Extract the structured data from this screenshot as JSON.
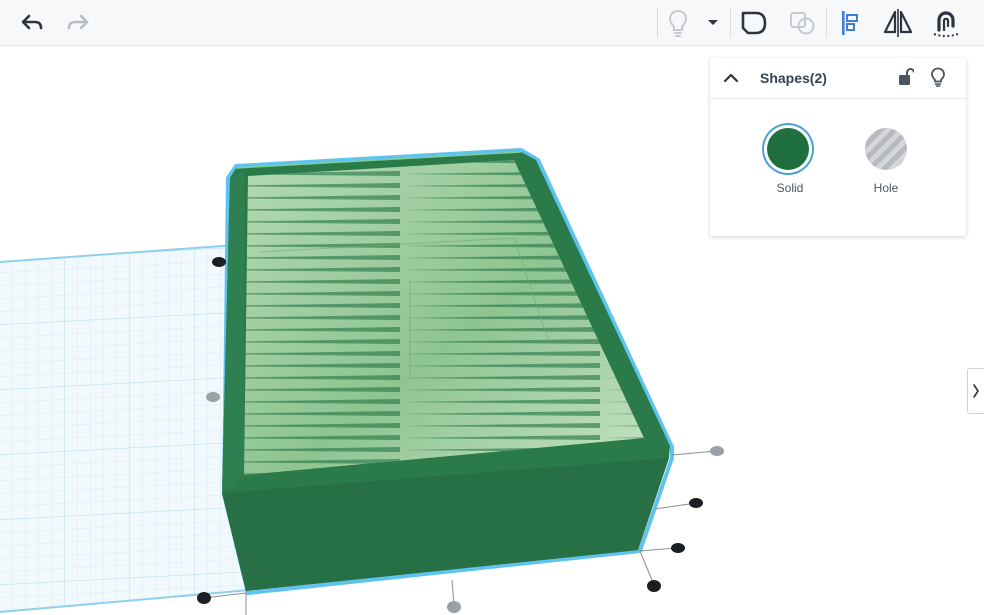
{
  "toolbar": {
    "undo_icon": "undo-arrow-icon",
    "redo_icon": "redo-arrow-icon",
    "notes_icon": "lightbulb-icon",
    "dropdown_icon": "caret-down-icon",
    "group_icon": "group-shape-icon",
    "ungroup_icon": "ungroup-shape-icon",
    "align_icon": "align-icon",
    "mirror_icon": "mirror-icon",
    "cruise_icon": "magnet-cruise-icon"
  },
  "shapes_panel": {
    "title": "Shapes(2)",
    "solid_label": "Solid",
    "hole_label": "Hole",
    "solid_color": "#1e6e3e"
  },
  "colors": {
    "accent": "#4aa0d9",
    "box_side": "#2a7a4a",
    "box_top_light": "#b9dcb8",
    "workplane_grid": "#cfe8f3"
  }
}
